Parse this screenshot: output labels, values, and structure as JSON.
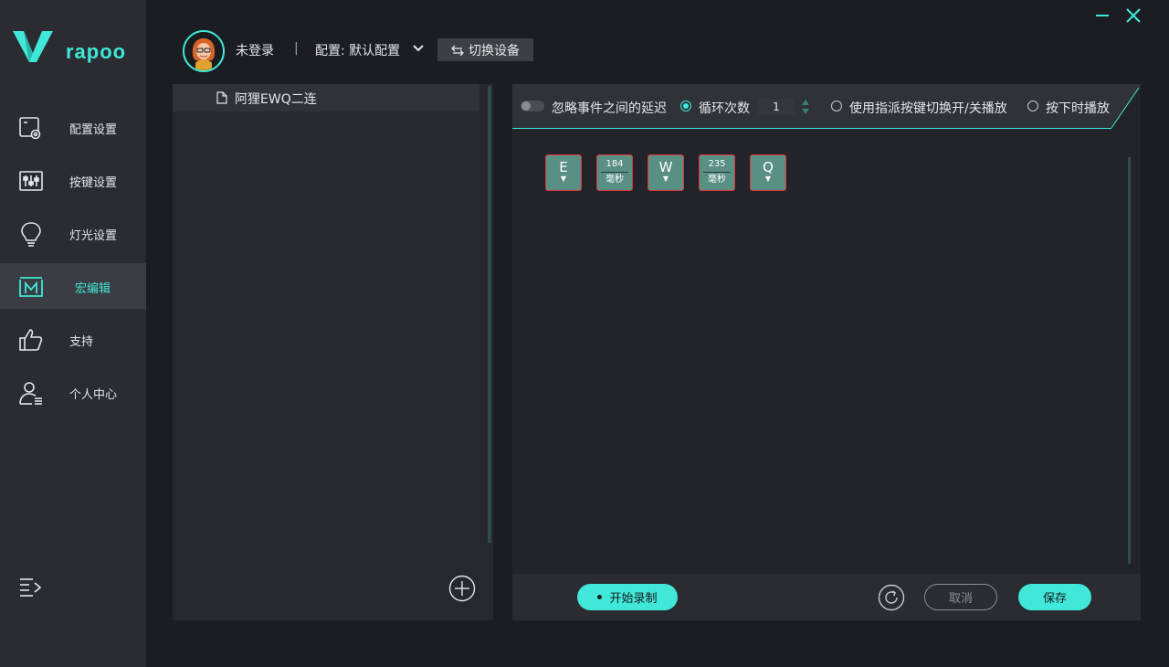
{
  "brand": {
    "name": "rapoo",
    "accent": "#3fe8d8"
  },
  "sidebar": {
    "items": [
      {
        "label": "配置设置",
        "icon": "config-icon"
      },
      {
        "label": "按键设置",
        "icon": "key-settings-icon"
      },
      {
        "label": "灯光设置",
        "icon": "bulb-icon"
      },
      {
        "label": "宏编辑",
        "icon": "macro-icon",
        "active": true
      },
      {
        "label": "支持",
        "icon": "thumbs-up-icon"
      },
      {
        "label": "个人中心",
        "icon": "user-icon"
      }
    ]
  },
  "topbar": {
    "login_status": "未登录",
    "separator": "|",
    "profile_label": "配置: 默认配置",
    "switch_device": "切换设备"
  },
  "macro_list": {
    "items": [
      {
        "name": "阿狸EWQ二连"
      }
    ]
  },
  "editor": {
    "ignore_delay": "忽略事件之间的延迟",
    "loop_count_label": "循环次数",
    "loop_count_value": "1",
    "toggle_mode": "使用指派按键切换开/关播放",
    "hold_mode": "按下时播放",
    "events": [
      {
        "type": "key",
        "key": "E"
      },
      {
        "type": "delay",
        "value": "184",
        "unit": "毫秒"
      },
      {
        "type": "key",
        "key": "W"
      },
      {
        "type": "delay",
        "value": "235",
        "unit": "毫秒"
      },
      {
        "type": "key",
        "key": "Q"
      }
    ],
    "record_label": "开始录制",
    "cancel_label": "取消",
    "save_label": "保存"
  }
}
